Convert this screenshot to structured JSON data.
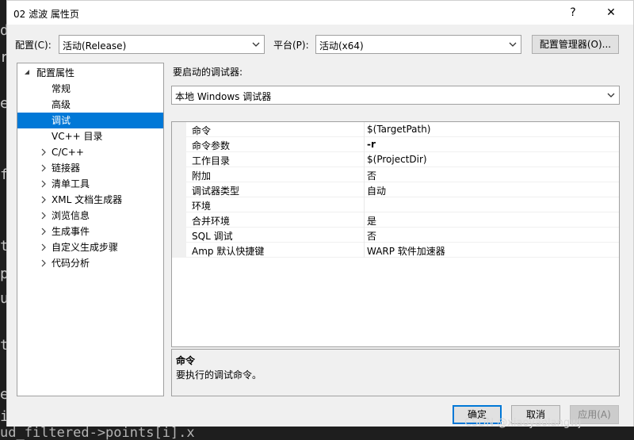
{
  "background_code": {
    "glyphs": [
      "d",
      "r",
      "e",
      "f",
      "t",
      "p",
      "u",
      "t",
      "e",
      "i"
    ],
    "bottom_line": "ud_filtered->points[i].x"
  },
  "window": {
    "title": "02 滤波 属性页",
    "help": "?",
    "close": "✕"
  },
  "top": {
    "config_label": "配置(C):",
    "config_value": "活动(Release)",
    "platform_label": "平台(P):",
    "platform_value": "活动(x64)",
    "config_manager": "配置管理器(O)..."
  },
  "tree": {
    "items": [
      {
        "label": "配置属性",
        "expander": "expanded",
        "level": 0
      },
      {
        "label": "常规",
        "expander": "none",
        "level": 1
      },
      {
        "label": "高级",
        "expander": "none",
        "level": 1
      },
      {
        "label": "调试",
        "expander": "none",
        "level": 1,
        "selected": true
      },
      {
        "label": "VC++ 目录",
        "expander": "none",
        "level": 1
      },
      {
        "label": "C/C++",
        "expander": "collapsed",
        "level": 1
      },
      {
        "label": "链接器",
        "expander": "collapsed",
        "level": 1
      },
      {
        "label": "清单工具",
        "expander": "collapsed",
        "level": 1
      },
      {
        "label": "XML 文档生成器",
        "expander": "collapsed",
        "level": 1
      },
      {
        "label": "浏览信息",
        "expander": "collapsed",
        "level": 1
      },
      {
        "label": "生成事件",
        "expander": "collapsed",
        "level": 1
      },
      {
        "label": "自定义生成步骤",
        "expander": "collapsed",
        "level": 1
      },
      {
        "label": "代码分析",
        "expander": "collapsed",
        "level": 1
      }
    ]
  },
  "debugger": {
    "label": "要启动的调试器:",
    "value": "本地 Windows 调试器"
  },
  "properties": [
    {
      "name": "命令",
      "value": "$(TargetPath)",
      "bold": false
    },
    {
      "name": "命令参数",
      "value": "-r",
      "bold": true
    },
    {
      "name": "工作目录",
      "value": "$(ProjectDir)",
      "bold": false
    },
    {
      "name": "附加",
      "value": "否",
      "bold": false
    },
    {
      "name": "调试器类型",
      "value": "自动",
      "bold": false
    },
    {
      "name": "环境",
      "value": "",
      "bold": false
    },
    {
      "name": "合并环境",
      "value": "是",
      "bold": false
    },
    {
      "name": "SQL 调试",
      "value": "否",
      "bold": false
    },
    {
      "name": "Amp 默认快捷键",
      "value": "WARP 软件加速器",
      "bold": false
    }
  ],
  "description": {
    "title": "命令",
    "text": "要执行的调试命令。"
  },
  "buttons": {
    "ok": "确定",
    "cancel": "取消",
    "apply": "应用(A)"
  },
  "watermark": "CSDN @xiaoyaolangwj",
  "colors": {
    "selection": "#0078d7",
    "dialog_bg": "#f0f0f0",
    "default_button_border": "#0078d7"
  }
}
